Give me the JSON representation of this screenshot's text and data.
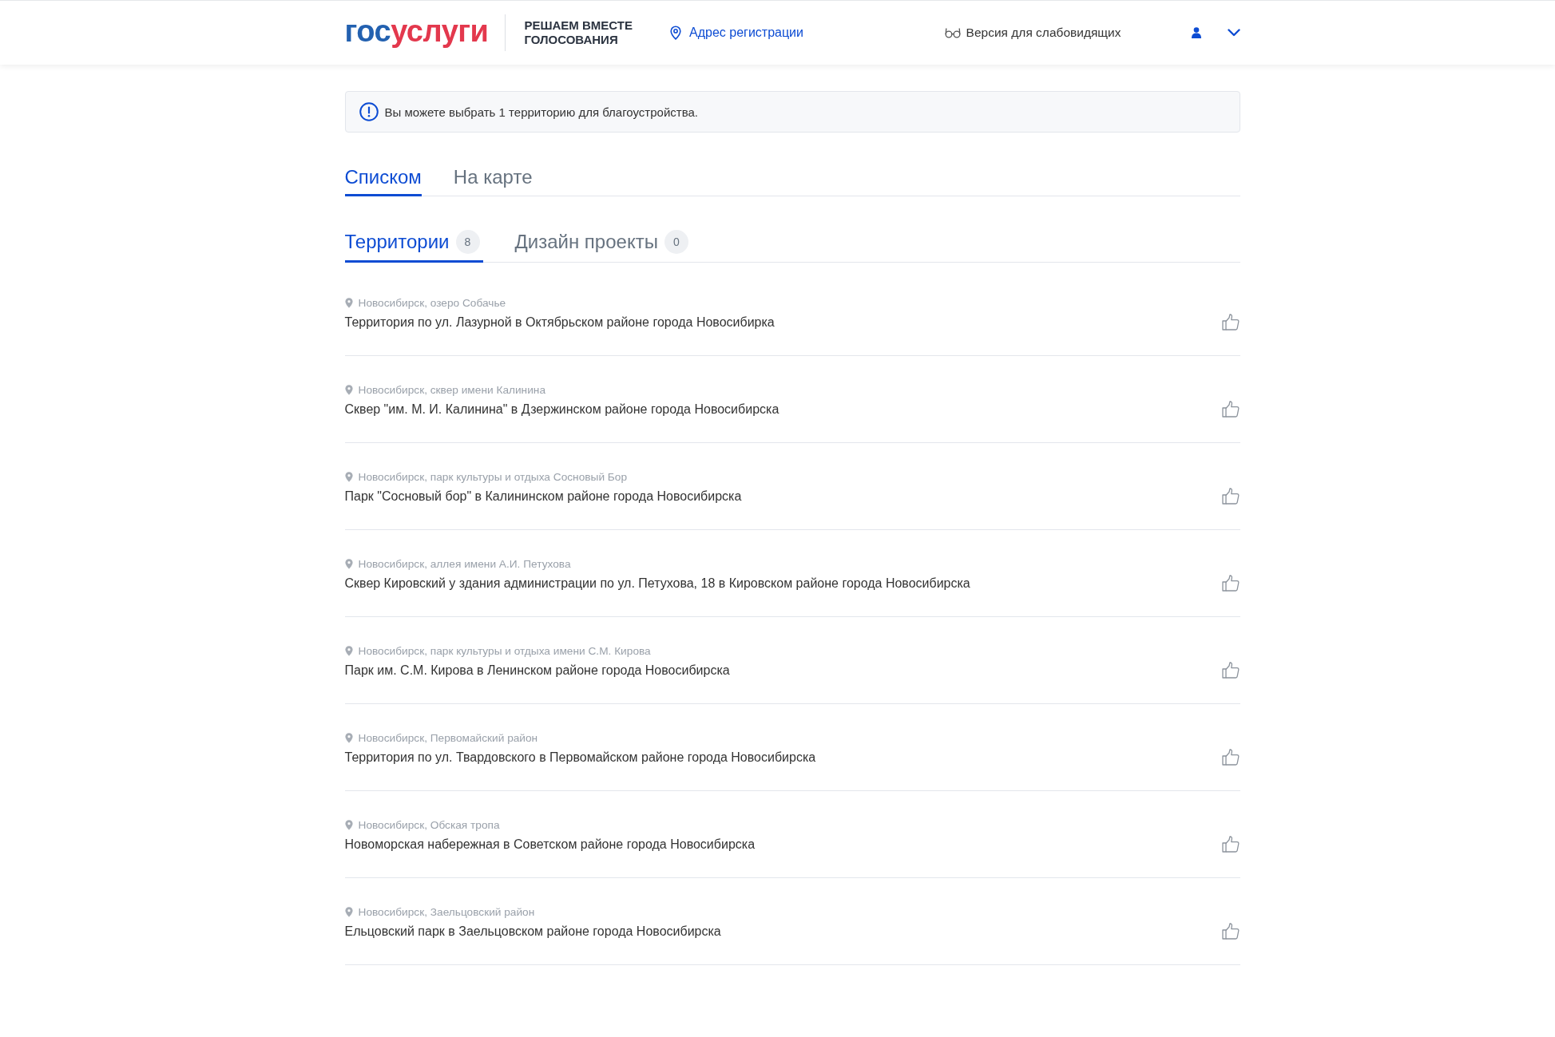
{
  "header": {
    "logo": [
      {
        "text": "гос",
        "color": "#2361b0"
      },
      {
        "text": "услуги",
        "color": "#e3384d"
      }
    ],
    "slogan": "РЕШАЕМ ВМЕСТЕ\nГОЛОСОВАНИЯ",
    "address_link": "Адрес регистрации",
    "accessibility_link": "Версия для слабовидящих"
  },
  "notice": "Вы можете выбрать 1 территорию для благоустройства.",
  "view_tabs": [
    {
      "label": "Списком",
      "selected": true
    },
    {
      "label": "На карте",
      "selected": false
    }
  ],
  "category_tabs": [
    {
      "label": "Территории",
      "count": "8",
      "selected": true
    },
    {
      "label": "Дизайн проекты",
      "count": "0",
      "selected": false
    }
  ],
  "territories": [
    {
      "location": "Новосибирск, озеро Собачье",
      "title": "Территория по ул. Лазурной в Октябрьском районе города Новосибирка"
    },
    {
      "location": "Новосибирск, сквер имени Калинина",
      "title": "Сквер \"им. М. И. Калинина\" в Дзержинском районе города Новосибирска"
    },
    {
      "location": "Новосибирск, парк культуры и отдыха Сосновый Бор",
      "title": "Парк \"Сосновый бор\" в Калининском районе города Новосибирска"
    },
    {
      "location": "Новосибирск, аллея имени А.И. Петухова",
      "title": "Сквер Кировский у здания администрации по ул. Петухова, 18 в Кировском районе города Новосибирска"
    },
    {
      "location": "Новосибирск, парк культуры и отдыха имени С.М. Кирова",
      "title": "Парк им. С.М. Кирова в Ленинском районе города Новосибирска"
    },
    {
      "location": "Новосибирск, Первомайский район",
      "title": "Территория по ул. Твардовского в Первомайском районе города Новосибирска"
    },
    {
      "location": "Новосибирск, Обская тропа",
      "title": "Новоморская набережная в Советском районе города Новосибирска"
    },
    {
      "location": "Новосибирск, Заельцовский район",
      "title": "Ельцовский парк в Заельцовском районе города Новосибирска"
    }
  ]
}
